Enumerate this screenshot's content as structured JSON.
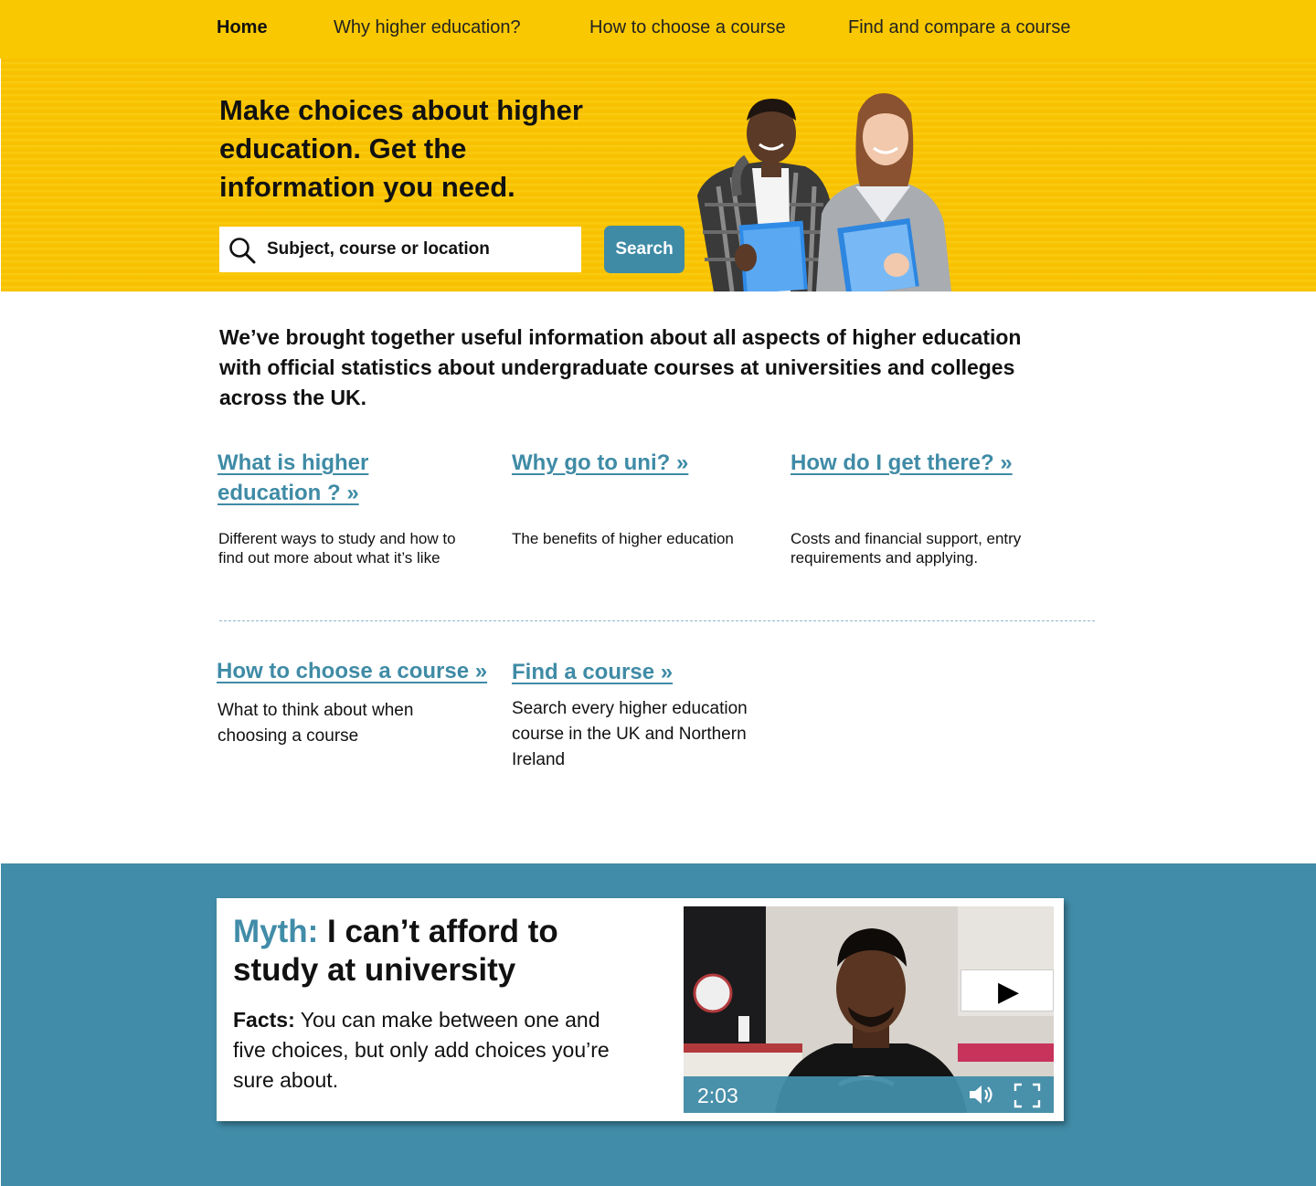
{
  "nav": {
    "items": [
      {
        "label": "Home",
        "active": true
      },
      {
        "label": "Why higher education?"
      },
      {
        "label": "How to choose a course"
      },
      {
        "label": "Find and compare a course"
      }
    ]
  },
  "hero": {
    "title": "Make choices about higher education.  Get the information you need.",
    "search_placeholder": "Subject, course or location",
    "search_button": "Search",
    "search_icon": "search-icon",
    "photo": "two-students-photo"
  },
  "intro": "We’ve brought together useful information about all aspects of higher education with official statistics about undergraduate courses at universities and colleges across the UK.",
  "cards": [
    {
      "link": "What is higher education ? »",
      "desc": "Different ways to study and how to find out more about what it’s like"
    },
    {
      "link": "Why go to uni? »",
      "desc": "The benefits of higher education"
    },
    {
      "link": "How do I get there? »",
      "desc": "Costs and financial support, entry requirements and applying."
    },
    {
      "link": "How to choose a course »",
      "desc": "What to think about when choosing a course"
    },
    {
      "link": "Find a course »",
      "desc": "Search every higher education course in the UK and Northern Ireland"
    }
  ],
  "myth": {
    "label": "Myth:",
    "title": " I can’t afford to study at university",
    "facts_label": "Facts:",
    "facts_text": " You can make between one and five choices, but only add choices you’re sure about.",
    "video": {
      "time": "2:03",
      "play_icon": "▶",
      "volume_icon": "volume-icon",
      "fullscreen_icon": "fullscreen-icon"
    }
  },
  "colors": {
    "brand_yellow": "#f9c800",
    "teal": "#418ca8",
    "link": "#3f8ba6"
  }
}
